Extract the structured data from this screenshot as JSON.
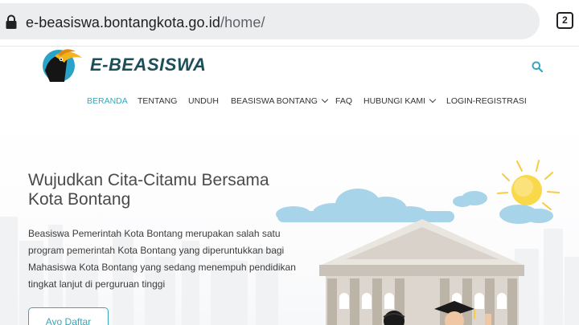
{
  "browser": {
    "url_host": "e-beasiswa.bontangkota.go.id",
    "url_path": "/home/",
    "tab_count": "2"
  },
  "site": {
    "brand": "E-BEASISWA",
    "colors": {
      "accent": "#3aa6b9",
      "brand": "#1b4f5a",
      "button_border": "#3aa6b9"
    }
  },
  "nav": {
    "items": [
      {
        "label": "BERANDA",
        "active": true
      },
      {
        "label": "TENTANG"
      },
      {
        "label": "UNDUH"
      },
      {
        "label": "BEASISWA BONTANG",
        "dropdown": true
      },
      {
        "label": "FAQ"
      },
      {
        "label": "HUBUNGI KAMI",
        "dropdown": true
      },
      {
        "label": "LOGIN-REGISTRASI"
      }
    ]
  },
  "hero": {
    "title": "Wujudkan Cita-Citamu Bersama Kota Bontang",
    "description": "Beasiswa Pemerintah Kota Bontang merupakan salah satu program pemerintah Kota Bontang yang diperuntukkan bagi Mahasiswa Kota Bontang yang sedang menempuh pendidikan tingkat lanjut di perguruan tinggi",
    "cta_label": "Ayo Daftar"
  },
  "icons": [
    "lock-icon",
    "search-icon",
    "hornbill-logo-icon",
    "chevron-down-icon",
    "sun-icon",
    "cloud-icon"
  ]
}
